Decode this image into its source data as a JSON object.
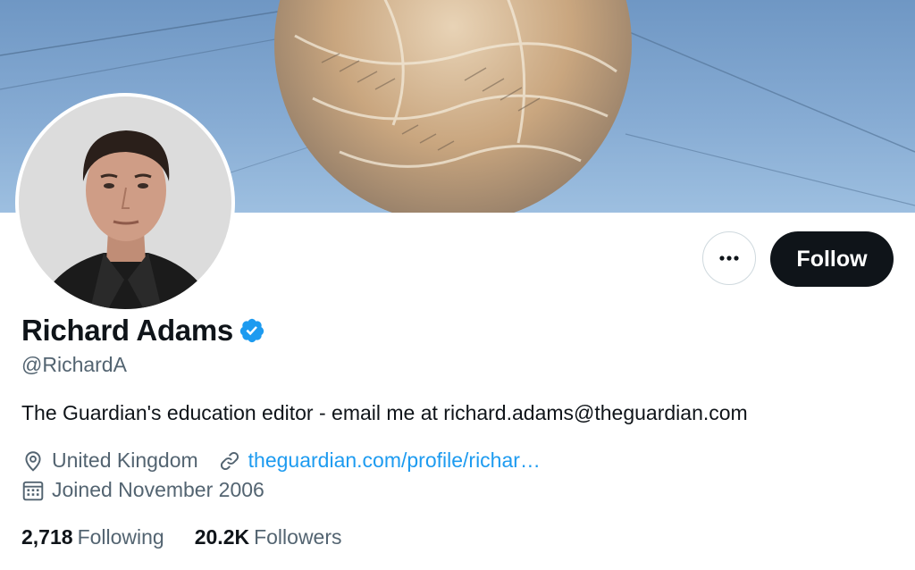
{
  "profile": {
    "display_name": "Richard Adams",
    "handle": "@RichardA",
    "bio": "The Guardian's education editor - email me at richard.adams@theguardian.com",
    "location": "United Kingdom",
    "website": "theguardian.com/profile/richar…",
    "joined": "Joined November 2006"
  },
  "stats": {
    "following_count": "2,718",
    "following_label": "Following",
    "followers_count": "20.2K",
    "followers_label": "Followers"
  },
  "actions": {
    "follow_label": "Follow"
  },
  "icons": {
    "more": "more-horizontal-icon",
    "verified": "verified-badge-icon",
    "location": "location-pin-icon",
    "link": "link-icon",
    "calendar": "calendar-icon"
  },
  "colors": {
    "text_primary": "#0f1419",
    "text_secondary": "#536471",
    "link": "#1d9bf0",
    "verified": "#1d9bf0",
    "follow_button": "#0f1419"
  }
}
